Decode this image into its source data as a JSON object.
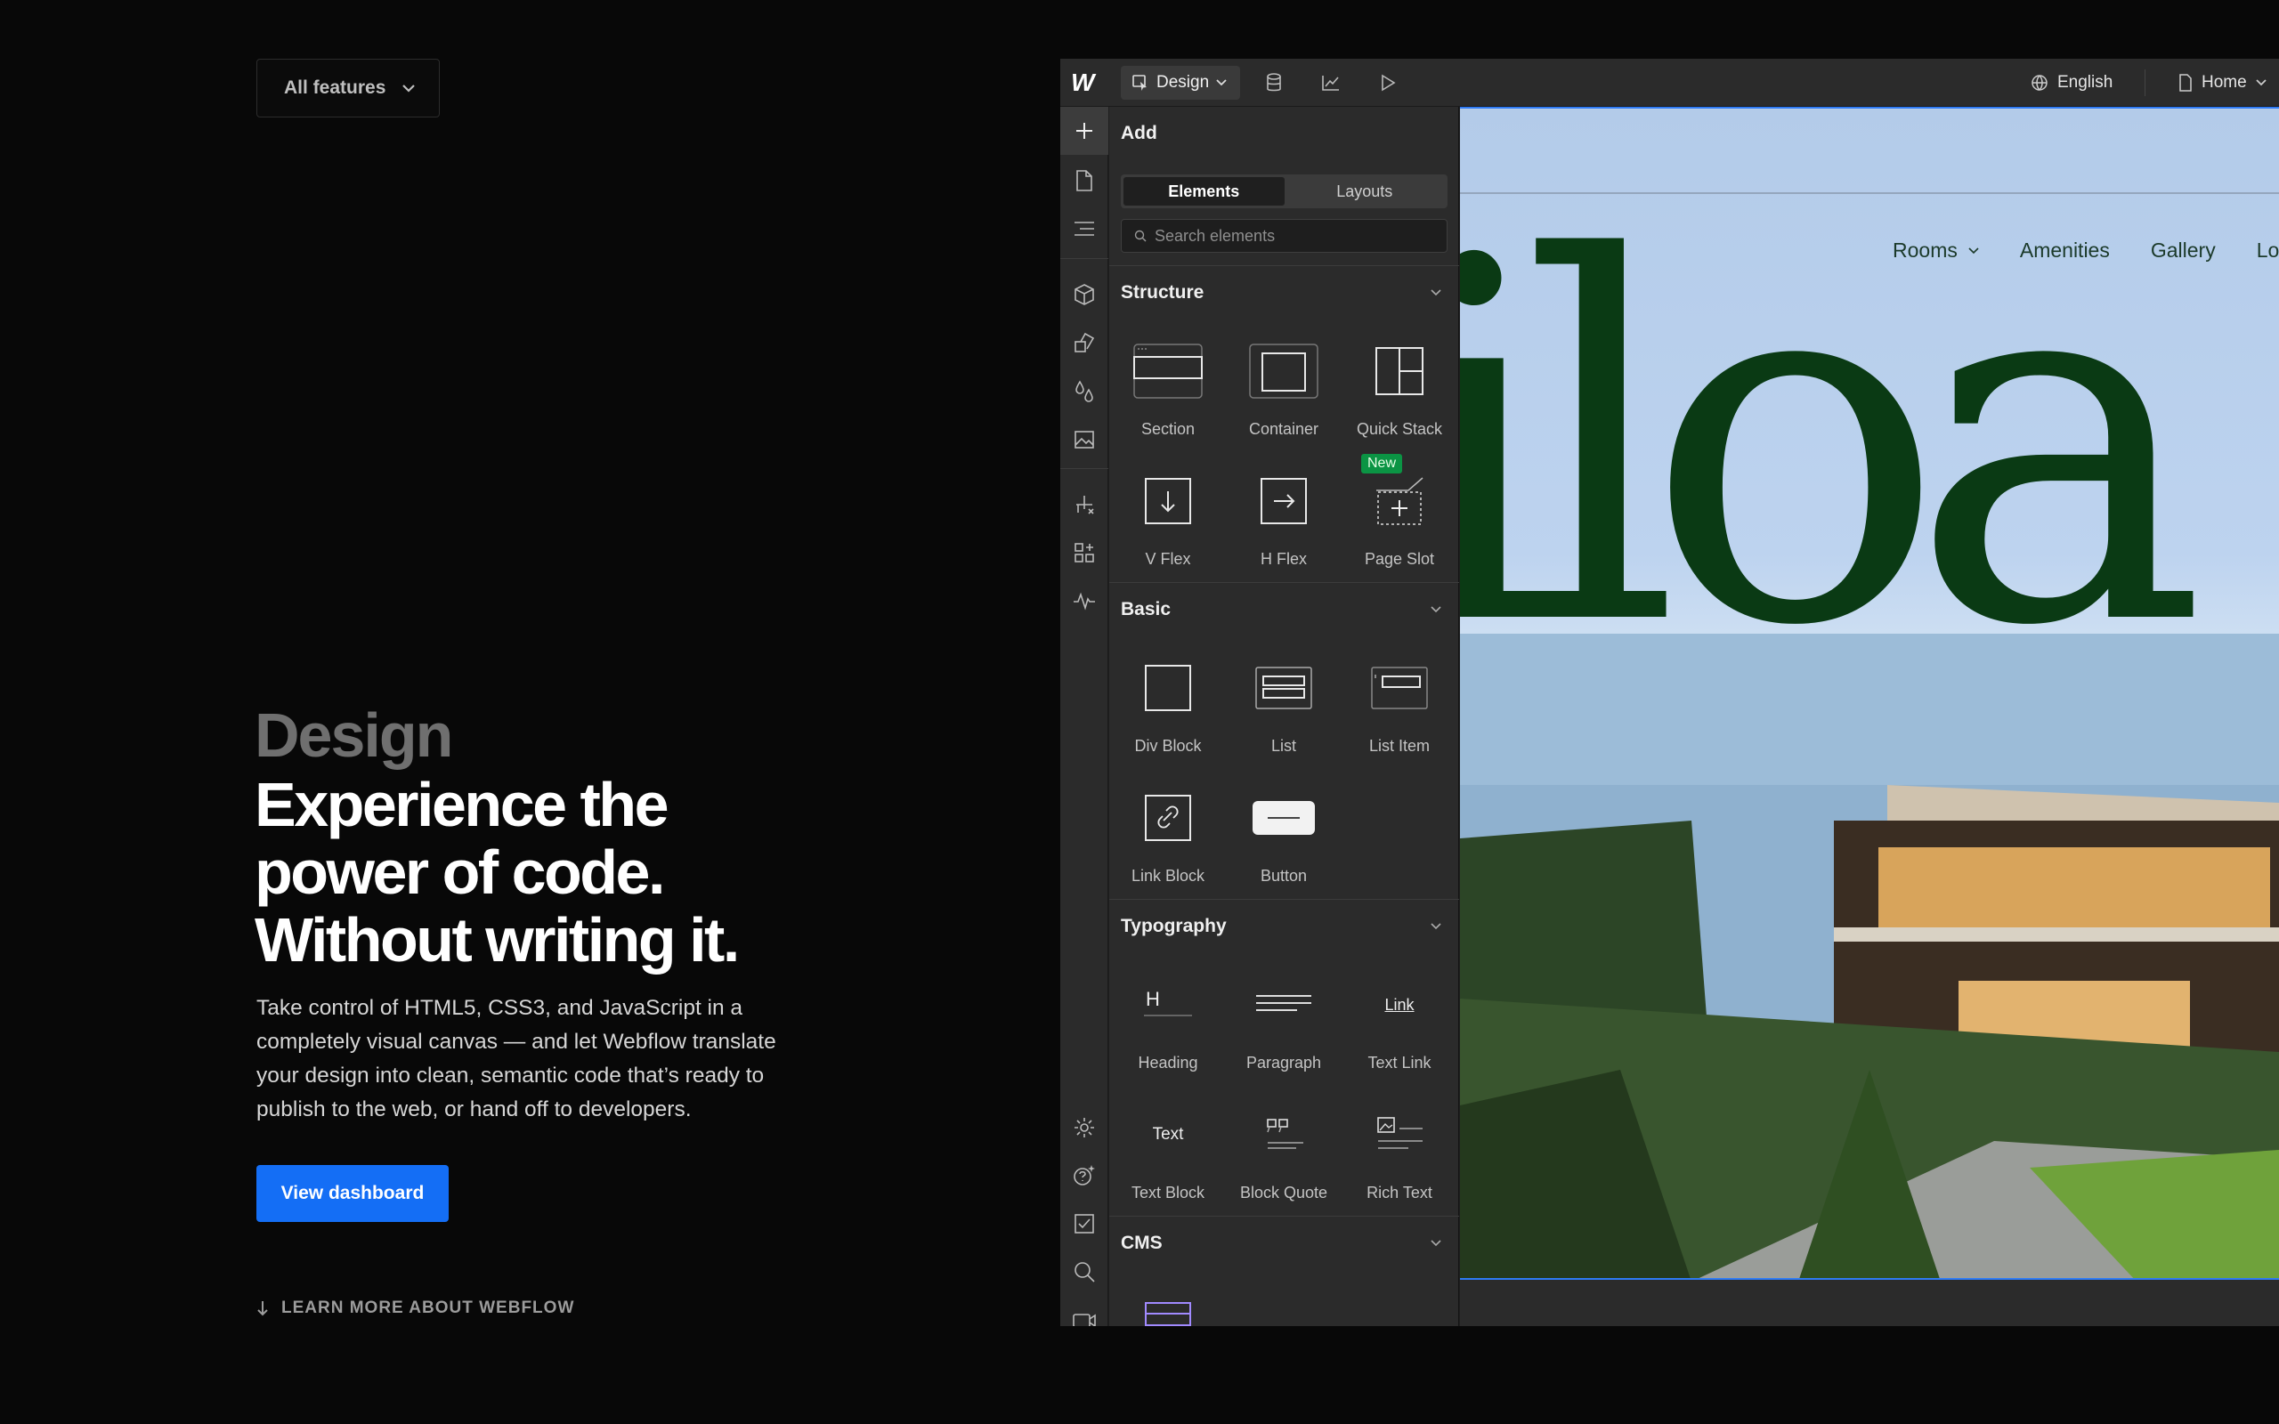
{
  "features_dropdown": {
    "label": "All features"
  },
  "hero": {
    "kicker": "Design",
    "title_lines": [
      "Experience the",
      "power of code.",
      "Without writing it."
    ],
    "body": "Take control of HTML5, CSS3, and JavaScript in a completely visual canvas — and let Webflow translate your design into clean, semantic code that’s ready to publish to the web, or hand off to developers.",
    "cta": "View dashboard",
    "learn_more": "LEARN MORE ABOUT WEBFLOW"
  },
  "colors": {
    "cta": "#146ef5",
    "new_badge": "#0b9444",
    "canvas_text": "#0a3a14"
  },
  "app": {
    "logo": "W",
    "mode": "Design",
    "language": "English",
    "page": "Home"
  },
  "panel": {
    "title": "Add",
    "tabs": [
      "Elements",
      "Layouts"
    ],
    "active_tab": "Elements",
    "search_placeholder": "Search elements",
    "sections": {
      "structure": {
        "title": "Structure",
        "items": [
          "Section",
          "Container",
          "Quick Stack",
          "V Flex",
          "H Flex",
          "Page Slot"
        ],
        "new_badge": "New"
      },
      "basic": {
        "title": "Basic",
        "items": [
          "Div Block",
          "List",
          "List Item",
          "Link Block",
          "Button"
        ]
      },
      "typography": {
        "title": "Typography",
        "items": [
          "Heading",
          "Paragraph",
          "Text Link",
          "Text Block",
          "Block Quote",
          "Rich Text"
        ],
        "icon_text": {
          "heading": "H",
          "link": "Link",
          "text": "Text"
        }
      },
      "cms": {
        "title": "CMS"
      }
    }
  },
  "canvas": {
    "nav": [
      "Rooms",
      "Amenities",
      "Gallery",
      "Loca"
    ],
    "hero_word": "iloa"
  }
}
